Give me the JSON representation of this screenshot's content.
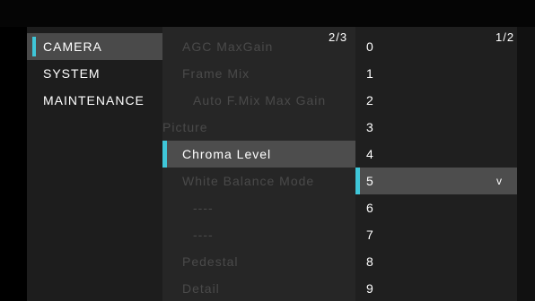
{
  "menu": {
    "items": [
      {
        "label": "CAMERA",
        "selected": true
      },
      {
        "label": "SYSTEM",
        "selected": false
      },
      {
        "label": "MAINTENANCE",
        "selected": false
      }
    ]
  },
  "submenu": {
    "page": "2/3",
    "items": [
      {
        "label": "AGC MaxGain"
      },
      {
        "label": "Frame Mix"
      },
      {
        "label": "Auto F.Mix Max Gain"
      },
      {
        "label": "Picture"
      },
      {
        "label": "Chroma Level"
      },
      {
        "label": "White Balance Mode"
      },
      {
        "label": "----"
      },
      {
        "label": "----"
      },
      {
        "label": "Pedestal"
      },
      {
        "label": "Detail"
      }
    ]
  },
  "values": {
    "page": "1/2",
    "selected_mark": "v",
    "items": [
      "0",
      "1",
      "2",
      "3",
      "4",
      "5",
      "6",
      "7",
      "8",
      "9"
    ]
  },
  "colors": {
    "accent": "#3fc6d8",
    "selection_bg": "#4d4d4d",
    "dim_text": "#4a4a4a"
  }
}
